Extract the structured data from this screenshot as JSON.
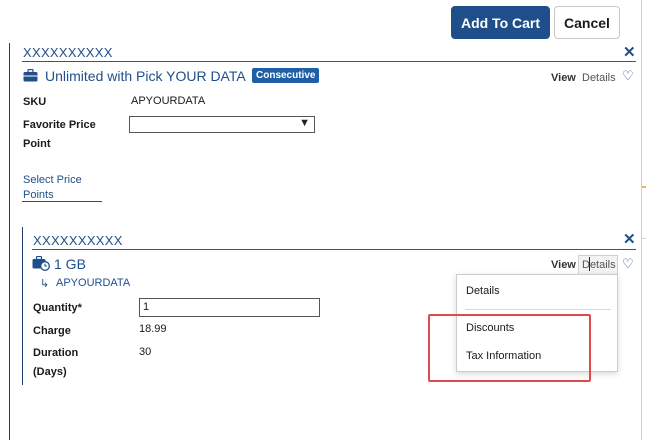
{
  "toolbar": {
    "add_to_cart_label": "Add To Cart",
    "cancel_label": "Cancel"
  },
  "plan": {
    "header": "XXXXXXXXXX",
    "icon": "briefcase-icon",
    "title": "Unlimited with Pick YOUR DATA",
    "badge": "Consecutive",
    "view_label": "View",
    "details_label": "Details",
    "sku_label": "SKU",
    "sku_value": "APYOURDATA",
    "favorite_label_line1": "Favorite Price",
    "favorite_label_line2": "Point",
    "favorite_value": "",
    "select_price_points_line1": "Select Price",
    "select_price_points_line2": "Points"
  },
  "addon": {
    "header": "XXXXXXXXXX",
    "icon": "briefcase-clock-icon",
    "title": "1 GB",
    "parent_arrow": "↳",
    "parent_sku": "APYOURDATA",
    "view_label": "View",
    "details_label": "Details",
    "quantity_label": "Quantity*",
    "quantity_value": "1",
    "charge_label": "Charge",
    "charge_value": "18.99",
    "duration_label_line1": "Duration",
    "duration_label_line2": "(Days)",
    "duration_value": "30"
  },
  "details_menu": {
    "items": [
      "Details",
      "Discounts",
      "Tax Information"
    ]
  },
  "colors": {
    "primary": "#1f4f8b",
    "badge": "#1f5fa8",
    "highlight": "#e04a4a"
  }
}
